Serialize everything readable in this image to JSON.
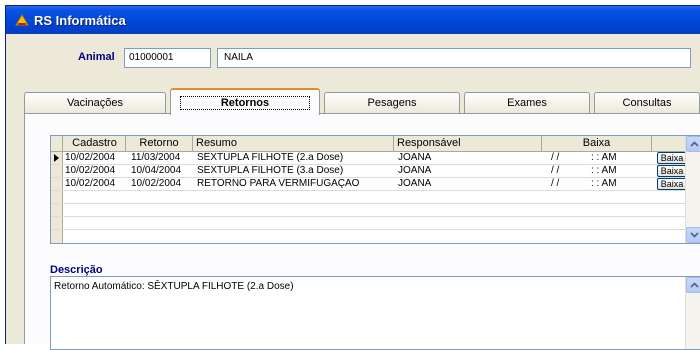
{
  "window": {
    "title": "RS Informática"
  },
  "animal": {
    "label": "Animal",
    "code": "01000001",
    "name": "NAILA"
  },
  "tabs": [
    {
      "label": "Vacinações",
      "active": false
    },
    {
      "label": "Retornos",
      "active": true
    },
    {
      "label": "Pesagens",
      "active": false
    },
    {
      "label": "Exames",
      "active": false
    },
    {
      "label": "Consultas",
      "active": false
    }
  ],
  "grid": {
    "headers": {
      "cadastro": "Cadastro",
      "retorno": "Retorno",
      "resumo": "Resumo",
      "responsavel": "Responsável",
      "baixa": "Baixa"
    },
    "rows": [
      {
        "cadastro": "10/02/2004",
        "retorno": "11/03/2004",
        "resumo": "SÊXTUPLA FILHOTE (2.a Dose)",
        "responsavel": "JOANA",
        "baixa_date": "/ /",
        "baixa_time": ": : AM",
        "button": "Baixa",
        "current": true
      },
      {
        "cadastro": "10/02/2004",
        "retorno": "10/04/2004",
        "resumo": "SÊXTUPLA FILHOTE (3.a Dose)",
        "responsavel": "JOANA",
        "baixa_date": "/ /",
        "baixa_time": ": : AM",
        "button": "Baixa",
        "current": false
      },
      {
        "cadastro": "10/02/2004",
        "retorno": "10/02/2004",
        "resumo": "RETORNO PARA VERMIFUGAÇÃO",
        "responsavel": "JOANA",
        "baixa_date": "/ /",
        "baixa_time": ": : AM",
        "button": "Baixa",
        "current": false
      }
    ]
  },
  "descricao": {
    "label": "Descrição",
    "text": "Retorno Automático: SÊXTUPLA FILHOTE (2.a Dose)"
  },
  "colors": {
    "titlebar": "#0347d8",
    "accent_label": "#000080",
    "active_tab_highlight": "#e68b2c"
  }
}
